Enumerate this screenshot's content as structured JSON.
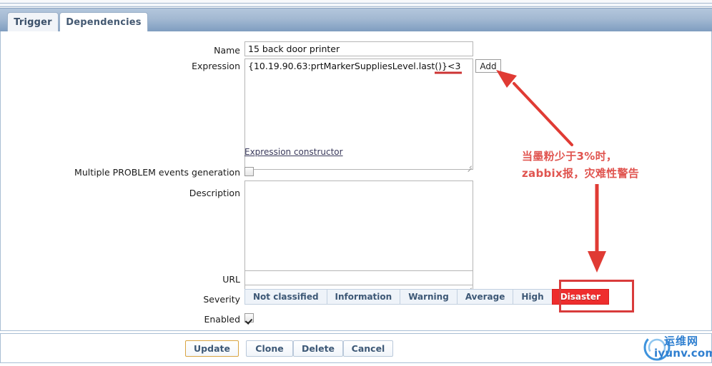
{
  "tabs": [
    {
      "label": "Trigger",
      "active": true
    },
    {
      "label": "Dependencies",
      "active": false
    }
  ],
  "form": {
    "name_label": "Name",
    "name_value": "15 back door printer",
    "expression_label": "Expression",
    "expression_value": "{10.19.90.63:prtMarkerSuppliesLevel.last()}<3",
    "add_button": "Add",
    "expression_constructor_link": "Expression constructor",
    "multiple_problem_label": "Multiple PROBLEM events generation",
    "multiple_problem_checked": false,
    "description_label": "Description",
    "description_value": "",
    "url_label": "URL",
    "url_value": "",
    "severity_label": "Severity",
    "severity_options": [
      "Not classified",
      "Information",
      "Warning",
      "Average",
      "High",
      "Disaster"
    ],
    "severity_selected": "Disaster",
    "enabled_label": "Enabled",
    "enabled_checked": true
  },
  "footer": {
    "update": "Update",
    "clone": "Clone",
    "delete": "Delete",
    "cancel": "Cancel"
  },
  "annotation": {
    "line1": "当墨粉少于3%时，",
    "line2": "zabbix报，灾难性警告",
    "color": "#e0544f",
    "highlight_color": "#d93b3b"
  },
  "watermark": {
    "line1": "运维网",
    "line2": "iyunv.com",
    "color": "#2f7fd0"
  }
}
